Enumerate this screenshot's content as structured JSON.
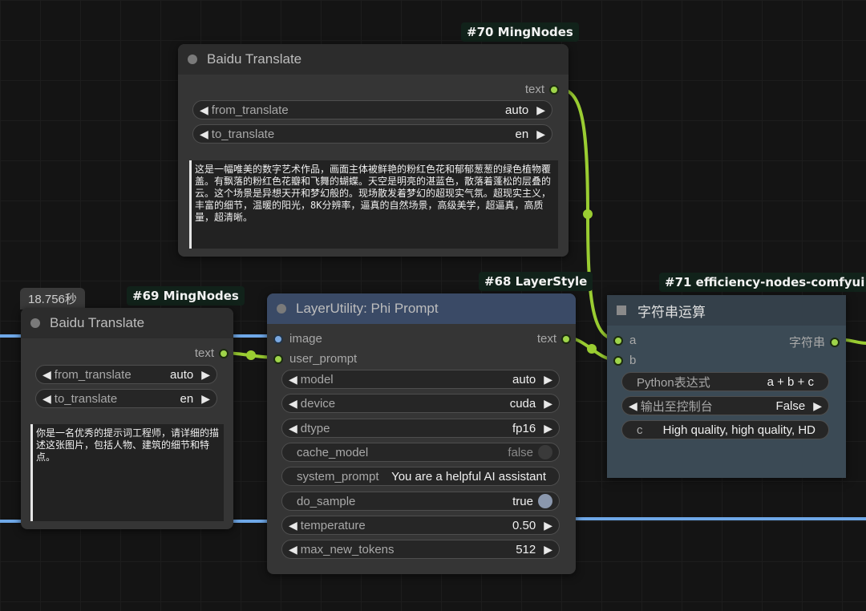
{
  "node70": {
    "badge": "#70 MingNodes",
    "title": "Baidu Translate",
    "output_label": "text",
    "from_label": "from_translate",
    "from_value": "auto",
    "to_label": "to_translate",
    "to_value": "en",
    "text": "这是一幅唯美的数字艺术作品，画面主体被鲜艳的粉红色花和郁郁葱葱的绿色植物覆盖。有飘落的粉红色花瓣和飞舞的蝴蝶。天空是明亮的湛蓝色，散落着蓬松的层叠的云。这个场景是异想天开和梦幻般的。现场散发着梦幻的超现实气氛。超现实主义，丰富的细节，温暖的阳光，8K分辨率，逼真的自然场景，高级美学，超逼真，高质量，超清晰。"
  },
  "node69": {
    "timer": "18.756秒",
    "badge": "#69 MingNodes",
    "title": "Baidu Translate",
    "output_label": "text",
    "from_label": "from_translate",
    "from_value": "auto",
    "to_label": "to_translate",
    "to_value": "en",
    "text": "你是一名优秀的提示词工程师，请详细的描述这张图片，包括人物、建筑的细节和特点。"
  },
  "node68": {
    "badge": "#68 LayerStyle",
    "title": "LayerUtility: Phi Prompt",
    "input_image": "image",
    "input_user_prompt": "user_prompt",
    "output_label": "text",
    "widgets": [
      {
        "label": "model",
        "value": "auto",
        "kind": "combo"
      },
      {
        "label": "device",
        "value": "cuda",
        "kind": "combo"
      },
      {
        "label": "dtype",
        "value": "fp16",
        "kind": "combo"
      },
      {
        "label": "cache_model",
        "value": "false",
        "kind": "toggle"
      },
      {
        "label": "system_prompt",
        "value": "You are a helpful AI assistant",
        "kind": "text"
      },
      {
        "label": "do_sample",
        "value": "true",
        "kind": "toggle"
      },
      {
        "label": "temperature",
        "value": "0.50",
        "kind": "combo"
      },
      {
        "label": "max_new_tokens",
        "value": "512",
        "kind": "combo"
      }
    ]
  },
  "node71": {
    "badge": "#71 efficiency-nodes-comfyui",
    "title": "字符串运算",
    "input_a": "a",
    "input_b": "b",
    "output_label": "字符串",
    "expr_label": "Python表达式",
    "expr_value": "a + b + c",
    "console_label": "输出至控制台",
    "console_value": "False",
    "c_label": "c",
    "c_value": "High quality, high quality, HD"
  },
  "colors": {
    "wire_string": "#9acd32",
    "wire_blue": "#6fa8e8",
    "node_bg": "#353535",
    "node71_bg": "#3b4a55"
  }
}
